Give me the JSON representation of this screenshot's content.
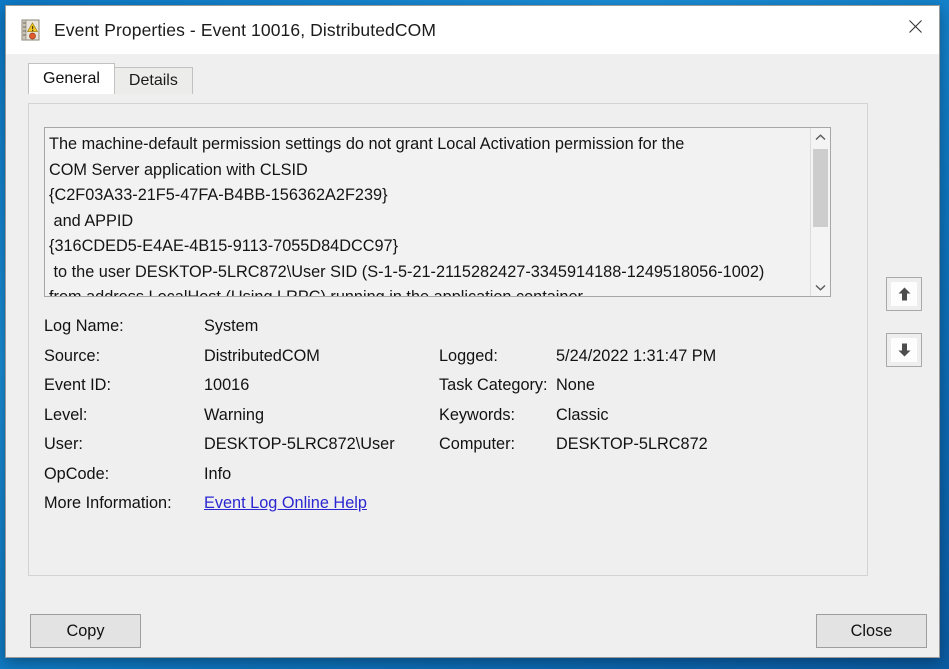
{
  "window": {
    "title": "Event Properties - Event 10016, DistributedCOM",
    "icon": "event-log-warning-icon",
    "close_label": "×"
  },
  "tabs": [
    {
      "label": "General",
      "active": true
    },
    {
      "label": "Details",
      "active": false
    }
  ],
  "description": {
    "lines": [
      "The machine-default permission settings do not grant Local Activation permission for the",
      "COM Server application with CLSID",
      "{C2F03A33-21F5-47FA-B4BB-156362A2F239}",
      " and APPID",
      "{316CDED5-E4AE-4B15-9113-7055D84DCC97}",
      " to the user DESKTOP-5LRC872\\User SID (S-1-5-21-2115282427-3345914188-1249518056-1002)",
      "from address LocalHost (Using LRPC) running in the application container"
    ],
    "scroll_position": "top"
  },
  "fields": {
    "log_name": {
      "label": "Log Name:",
      "value": "System"
    },
    "source": {
      "label": "Source:",
      "value": "DistributedCOM"
    },
    "event_id": {
      "label": "Event ID:",
      "value": "10016"
    },
    "level": {
      "label": "Level:",
      "value": "Warning"
    },
    "user": {
      "label": "User:",
      "value": "DESKTOP-5LRC872\\User"
    },
    "opcode": {
      "label": "OpCode:",
      "value": "Info"
    },
    "more_information": {
      "label": "More Information:",
      "link_text": "Event Log Online Help"
    },
    "logged": {
      "label": "Logged:",
      "value": "5/24/2022 1:31:47 PM"
    },
    "task_category": {
      "label": "Task Category:",
      "value": "None"
    },
    "keywords": {
      "label": "Keywords:",
      "value": "Classic"
    },
    "computer": {
      "label": "Computer:",
      "value": "DESKTOP-5LRC872"
    }
  },
  "nav": {
    "previous_icon": "arrow-up-icon",
    "next_icon": "arrow-down-icon"
  },
  "buttons": {
    "copy": "Copy",
    "close": "Close"
  },
  "colors": {
    "link": "#2a27d0",
    "dialog_bg": "#efefef",
    "titlebar_bg": "#ffffff",
    "desktop_bg": "#0e77c0"
  }
}
